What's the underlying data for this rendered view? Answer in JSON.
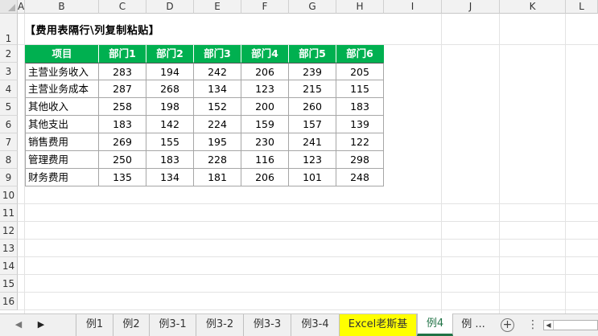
{
  "columns": [
    "A",
    "B",
    "C",
    "D",
    "E",
    "F",
    "G",
    "H",
    "I",
    "J",
    "K",
    "L"
  ],
  "rows": [
    "1",
    "2",
    "3",
    "4",
    "5",
    "6",
    "7",
    "8",
    "9",
    "10",
    "11",
    "12",
    "13",
    "14",
    "15",
    "16"
  ],
  "title": "【费用表隔行\\列复制粘贴】",
  "table": {
    "headers": [
      "项目",
      "部门1",
      "部门2",
      "部门3",
      "部门4",
      "部门5",
      "部门6"
    ],
    "rows": [
      {
        "label": "主营业务收入",
        "values": [
          "283",
          "194",
          "242",
          "206",
          "239",
          "205"
        ]
      },
      {
        "label": "主营业务成本",
        "values": [
          "287",
          "268",
          "134",
          "123",
          "215",
          "115"
        ]
      },
      {
        "label": "其他收入",
        "values": [
          "258",
          "198",
          "152",
          "200",
          "260",
          "183"
        ]
      },
      {
        "label": "其他支出",
        "values": [
          "183",
          "142",
          "224",
          "159",
          "157",
          "139"
        ]
      },
      {
        "label": "销售费用",
        "values": [
          "269",
          "155",
          "195",
          "230",
          "241",
          "122"
        ]
      },
      {
        "label": "管理费用",
        "values": [
          "250",
          "183",
          "228",
          "116",
          "123",
          "298"
        ]
      },
      {
        "label": "财务费用",
        "values": [
          "135",
          "134",
          "181",
          "206",
          "101",
          "248"
        ]
      }
    ]
  },
  "tabs": [
    "例1",
    "例2",
    "例3-1",
    "例3-2",
    "例3-3",
    "例3-4",
    "Excel老斯基",
    "例4",
    "例 ..."
  ],
  "active_tab": "例4",
  "colors": {
    "header_green": "#00b050",
    "tab_yellow": "#ffff00",
    "excel_green": "#217346"
  }
}
